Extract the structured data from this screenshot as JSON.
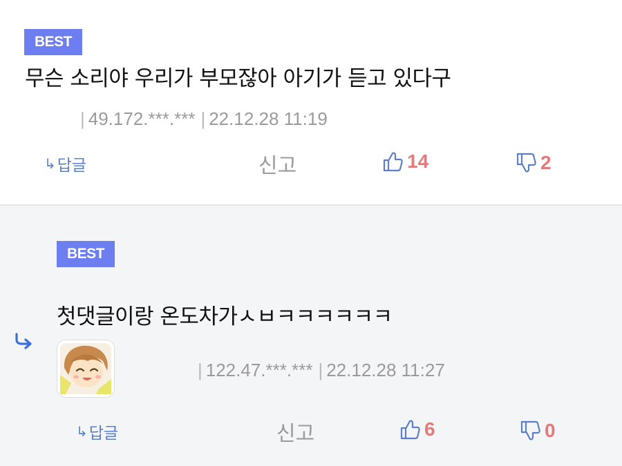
{
  "comments": [
    {
      "badge": "BEST",
      "text": "무슨 소리야 우리가 부모잖아 아기가 듣고 있다구",
      "ip": "49.172.***.***",
      "date": "22.12.28 11:19",
      "reply_label": "답글",
      "report_label": "신고",
      "likes": "14",
      "dislikes": "2"
    },
    {
      "badge": "BEST",
      "text": "첫댓글이랑 온도차가ㅅㅂㅋㅋㅋㅋㅋㅋ",
      "ip": "122.47.***.***",
      "date": "22.12.28 11:27",
      "reply_label": "답글",
      "report_label": "신고",
      "likes": "6",
      "dislikes": "0"
    }
  ],
  "colors": {
    "badge_bg": "#6c7ef0",
    "vote_count": "#e07c7c",
    "vote_icon": "#5b7fc7",
    "reply_link": "#5b7fc7",
    "nested_bg": "#f4f5f7"
  },
  "icons": {
    "reply": "reply-arrow-icon",
    "like": "thumbs-up-icon",
    "dislike": "thumbs-down-icon",
    "nested": "nested-reply-arrow-icon"
  }
}
